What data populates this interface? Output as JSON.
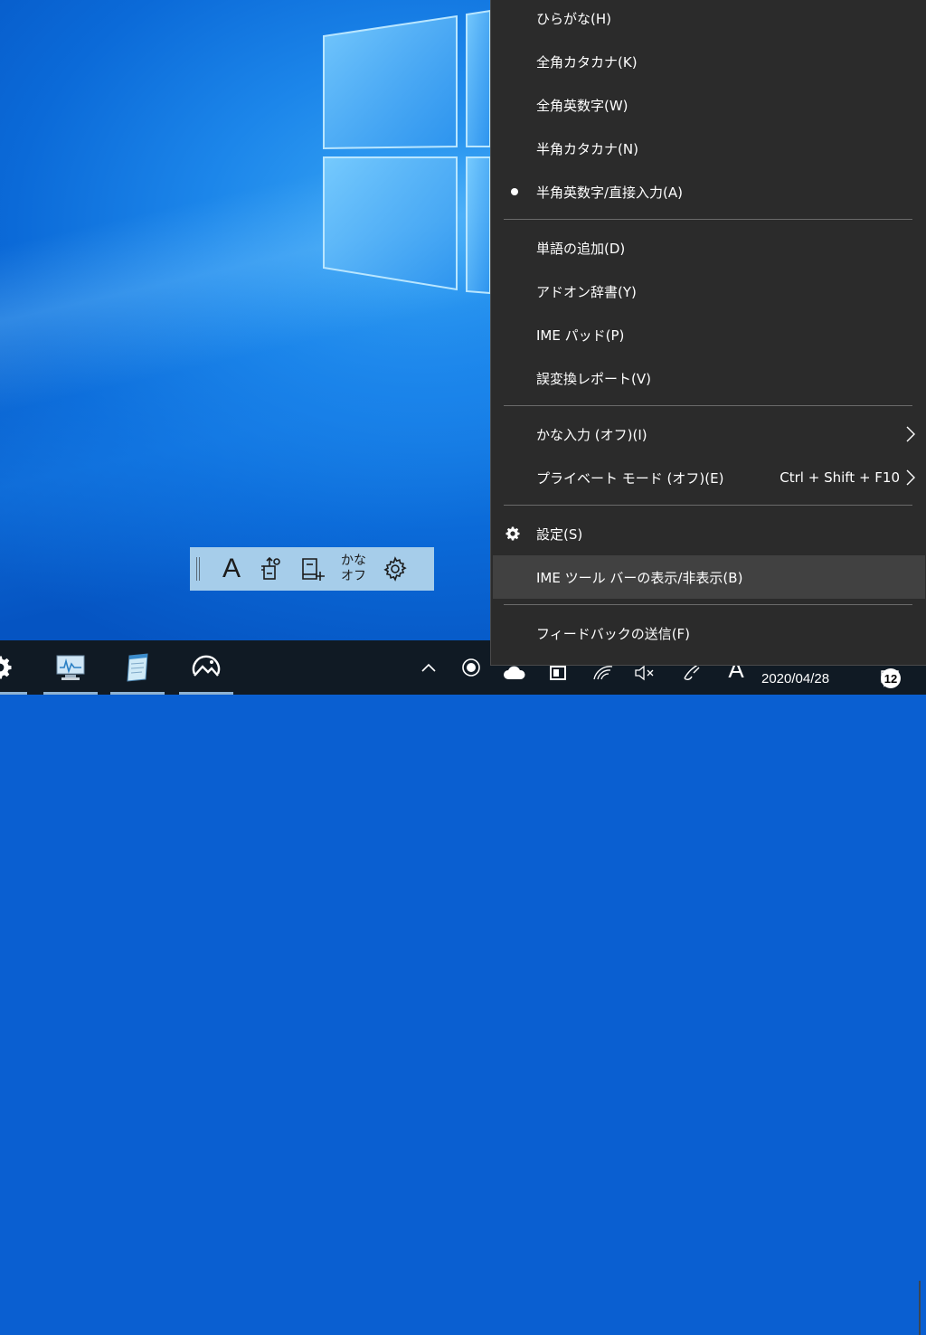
{
  "menu": {
    "items": [
      {
        "label": "ひらがな(H)"
      },
      {
        "label": "全角カタカナ(K)"
      },
      {
        "label": "全角英数字(W)"
      },
      {
        "label": "半角カタカナ(N)"
      },
      {
        "label": "半角英数字/直接入力(A)",
        "selected": true
      },
      {
        "label": "単語の追加(D)"
      },
      {
        "label": "アドオン辞書(Y)"
      },
      {
        "label": "IME パッド(P)"
      },
      {
        "label": "誤変換レポート(V)"
      },
      {
        "label": "かな入力 (オフ)(I)",
        "submenu": true
      },
      {
        "label": "プライベート モード (オフ)(E)",
        "shortcut": "Ctrl + Shift + F10",
        "submenu": true
      },
      {
        "label": "設定(S)",
        "icon": "gear-icon"
      },
      {
        "label": "IME ツール バーの表示/非表示(B)",
        "hovered": true
      },
      {
        "label": "フィードバックの送信(F)"
      }
    ]
  },
  "ime_toolbar": {
    "mode_label": "A",
    "kana_top": "かな",
    "kana_bottom": "オフ",
    "icons": [
      "grip-icon",
      "input-mode-icon",
      "tools-icon",
      "dictionary-add-icon",
      "kana-off-toggle",
      "settings-gear-icon"
    ]
  },
  "taskbar": {
    "apps": [
      "settings-icon",
      "resource-monitor-icon",
      "notepad-icon",
      "photos-icon"
    ],
    "tray": [
      "show-hidden-icons-chevron",
      "record-icon",
      "cloud-icon",
      "battery-icon",
      "wifi-icon",
      "volume-muted-icon",
      "pen-icon",
      "ime-mode-icon"
    ],
    "ime_indicator": "A",
    "date": "2020/04/28",
    "notification_count": "12"
  },
  "colors": {
    "menu_bg": "#2b2b2b",
    "menu_hover": "#414141",
    "taskbar_bg": "#101a24",
    "toolbar_bg": "#a6cdea",
    "wallpaper": "#0b6ad8"
  }
}
